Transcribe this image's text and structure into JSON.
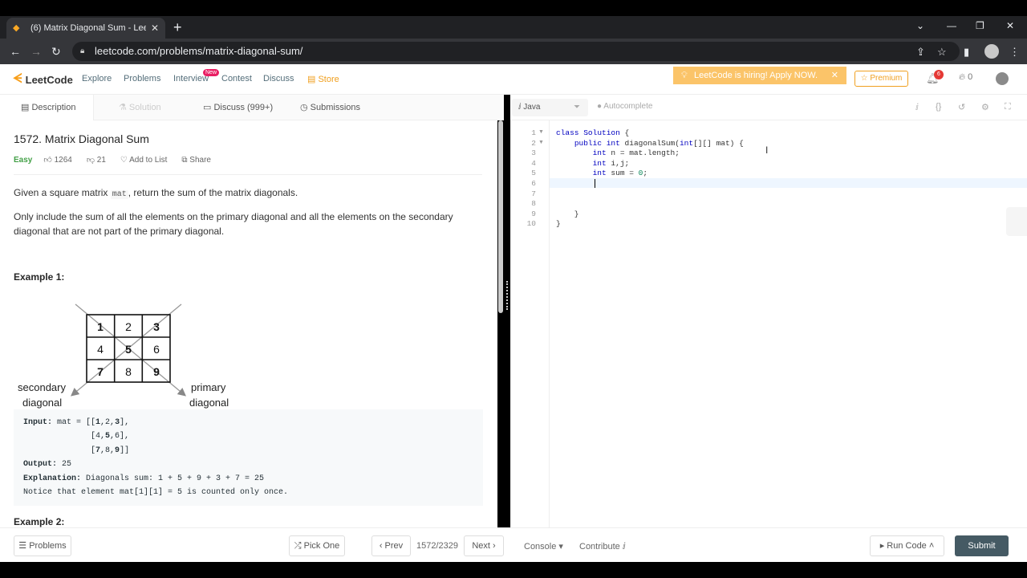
{
  "browser": {
    "tab_title": "(6) Matrix Diagonal Sum - LeetCo",
    "url": "leetcode.com/problems/matrix-diagonal-sum/"
  },
  "nav": {
    "logo": "LeetCode",
    "links": [
      "Explore",
      "Problems",
      "Interview",
      "Contest",
      "Discuss",
      "Store"
    ],
    "interview_badge": "New",
    "hiring": "LeetCode is hiring! Apply NOW.",
    "premium": "Premium",
    "notifications": "6",
    "points": "0"
  },
  "left_tabs": [
    "Description",
    "Solution",
    "Discuss (999+)",
    "Submissions"
  ],
  "problem": {
    "title": "1572. Matrix Diagonal Sum",
    "difficulty": "Easy",
    "likes": "1264",
    "dislikes": "21",
    "add_to_list": "Add to List",
    "share": "Share",
    "p1_before": "Given a square matrix ",
    "p1_code": "mat",
    "p1_after": ", return the sum of the matrix diagonals.",
    "p2": "Only include the sum of all the elements on the primary diagonal and all the elements on the secondary diagonal that are not part of the primary diagonal.",
    "example1_title": "Example 1:",
    "example2_title": "Example 2:",
    "grid": [
      [
        "1",
        "2",
        "3"
      ],
      [
        "4",
        "5",
        "6"
      ],
      [
        "7",
        "8",
        "9"
      ]
    ],
    "diag_secondary_1": "secondary",
    "diag_secondary_2": "diagonal",
    "diag_primary_1": "primary",
    "diag_primary_2": "diagonal",
    "ex_input_label": "Input:",
    "ex_input_pre": " mat = [[",
    "ex_output_label": "Output:",
    "ex_output_value": " 25",
    "ex_explanation_label": "Explanation:",
    "ex_explanation_value": " Diagonals sum: 1 + 5 + 9 + 3 + 7 = 25",
    "ex_note": "Notice that element mat[1][1] = 5 is counted only once."
  },
  "editor": {
    "language": "Java",
    "autocomplete": "Autocomplete",
    "line_numbers": [
      "1",
      "2",
      "3",
      "4",
      "5",
      "6",
      "7",
      "8",
      "9",
      "10"
    ]
  },
  "bottom": {
    "problems": "Problems",
    "pick_one": "Pick One",
    "prev": "Prev",
    "counter": "1572/2329",
    "next": "Next",
    "console": "Console",
    "contribute": "Contribute",
    "run_code": "Run Code",
    "submit": "Submit"
  }
}
